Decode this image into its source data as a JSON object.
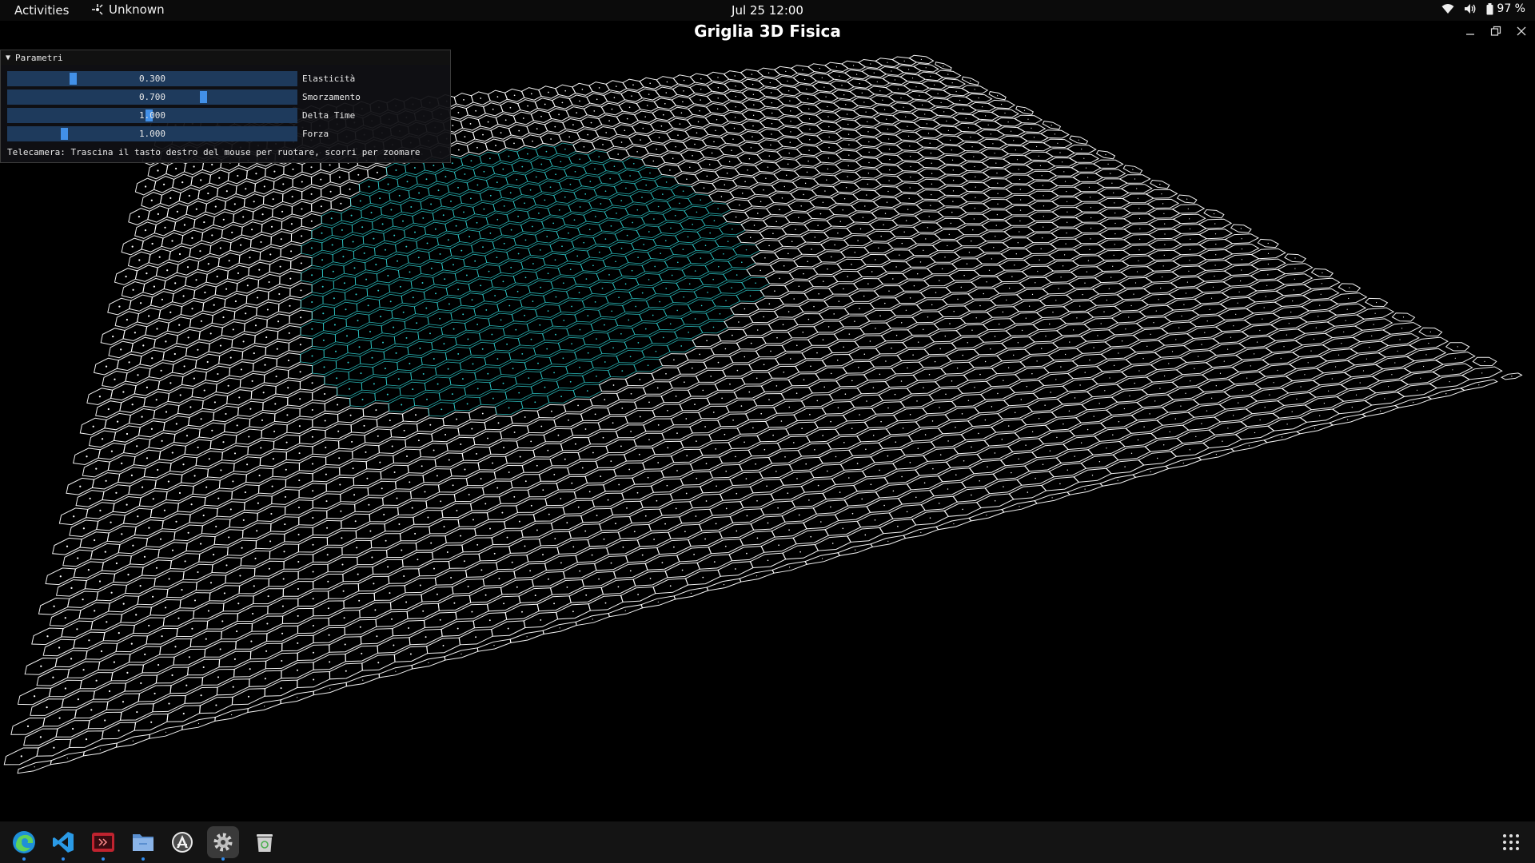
{
  "topbar": {
    "activities": "Activities",
    "app_name": "Unknown",
    "clock": "Jul 25  12:00",
    "battery": "97 %",
    "icons": [
      "app-indicator-icon",
      "wifi-icon",
      "volume-icon",
      "battery-icon"
    ]
  },
  "window": {
    "title": "Griglia 3D Fisica",
    "buttons": [
      "minimize-icon",
      "restore-icon",
      "close-icon"
    ]
  },
  "panel": {
    "title": "Parametri",
    "sliders": [
      {
        "label": "Elasticità",
        "value": "0.300",
        "level": 0.22
      },
      {
        "label": "Smorzamento",
        "value": "0.700",
        "level": 0.68
      },
      {
        "label": "Delta Time",
        "value": "1.000",
        "level": 0.49
      },
      {
        "label": "Forza",
        "value": "1.000",
        "level": 0.19
      }
    ],
    "hint": "Telecamera: Trascina il tasto destro del mouse per ruotare, scorri per zoomare"
  },
  "scene": {
    "grid_color": "#ffffff",
    "highlight_color": "#2fd0d0",
    "background": "#000000"
  },
  "dock": {
    "apps": [
      {
        "icon": "edge-browser-icon",
        "running": true
      },
      {
        "icon": "vscode-icon",
        "running": true
      },
      {
        "icon": "terminal-app-icon",
        "running": true
      },
      {
        "icon": "files-icon",
        "running": true
      },
      {
        "icon": "software-center-icon",
        "running": false
      },
      {
        "icon": "settings-gear-icon",
        "running": true,
        "active": true
      },
      {
        "icon": "trash-icon",
        "running": false
      }
    ],
    "grid_button": "show-apps-grid-icon"
  }
}
